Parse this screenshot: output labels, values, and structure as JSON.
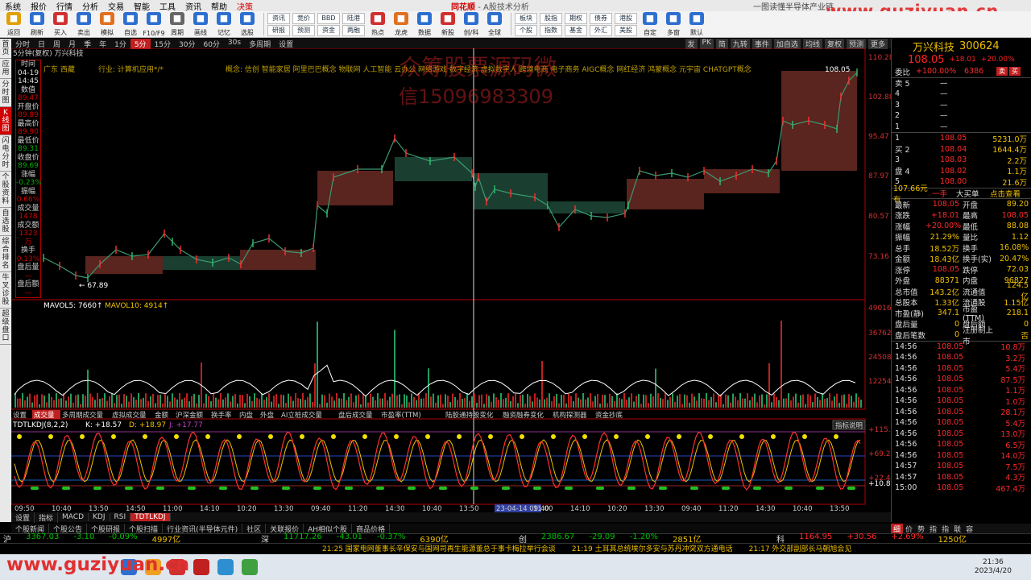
{
  "menu": {
    "items": [
      "系统",
      "报价",
      "行情",
      "分析",
      "交易",
      "智能",
      "工具",
      "资讯",
      "帮助",
      "决策"
    ],
    "app_title_brand": "同花顺",
    "app_title_rest": "- A股技术分析",
    "right_title": "一图读懂半导体产业链"
  },
  "toolbar": {
    "buttons": [
      {
        "label": "返回",
        "icon": "back-icon",
        "color": "#e0a000"
      },
      {
        "label": "刷新",
        "icon": "refresh-icon",
        "color": "#2d6fd0"
      },
      {
        "label": "买入",
        "icon": "buy-icon",
        "color": "#d03030"
      },
      {
        "label": "卖出",
        "icon": "sell-icon",
        "color": "#2d6fd0"
      },
      {
        "label": "模拟",
        "icon": "simulate-icon",
        "color": "#e07020"
      },
      {
        "label": "自选",
        "icon": "watchlist-icon",
        "color": "#2d6fd0"
      },
      {
        "label": "F10/F9",
        "icon": "f10-icon",
        "color": "#2d6fd0"
      },
      {
        "label": "周期",
        "icon": "period-icon",
        "color": "#666"
      },
      {
        "label": "画线",
        "icon": "draw-line-icon",
        "color": "#2d6fd0"
      },
      {
        "label": "记忆",
        "icon": "memory-icon",
        "color": "#2d6fd0"
      },
      {
        "label": "选股",
        "icon": "screener-icon",
        "color": "#2d6fd0"
      }
    ],
    "grid_buttons": [
      [
        "资讯",
        "研报"
      ],
      [
        "竞价",
        "预测"
      ],
      [
        "BBD",
        "资金"
      ],
      [
        "陆港",
        "两融"
      ]
    ],
    "buttons2": [
      {
        "label": "热点",
        "icon": "hot-icon",
        "color": "#d03030"
      },
      {
        "label": "龙虎",
        "icon": "dragon-icon",
        "color": "#e07020"
      },
      {
        "label": "数据",
        "icon": "data-icon",
        "color": "#2d6fd0"
      },
      {
        "label": "新股",
        "icon": "ipo-icon",
        "color": "#d03030"
      },
      {
        "label": "创/科",
        "icon": "star-icon",
        "color": "#2d6fd0"
      },
      {
        "label": "全球",
        "icon": "globe-icon",
        "color": "#2d6fd0"
      }
    ],
    "grid_buttons2": [
      [
        "板块",
        "个股"
      ],
      [
        "股指",
        "指数"
      ],
      [
        "期权",
        "基金"
      ],
      [
        "债券",
        "外汇"
      ],
      [
        "港股",
        "美股"
      ]
    ],
    "buttons3": [
      {
        "label": "自定",
        "icon": "custom-icon",
        "color": "#2d6fd0"
      },
      {
        "label": "多窗",
        "icon": "multiwindow-icon",
        "color": "#2d6fd0"
      },
      {
        "label": "默认",
        "icon": "default-icon",
        "color": "#2d6fd0"
      }
    ]
  },
  "left_tabs": [
    "首页",
    "应用",
    "分时图",
    "K线图",
    "闪电分时",
    "个股资料",
    "自选股",
    "综合排名",
    "牛叉诊股",
    "超级盘口"
  ],
  "period_bar": {
    "items": [
      "分时",
      "日",
      "周",
      "月",
      "季",
      "年",
      "1分",
      "5分",
      "15分",
      "30分",
      "60分",
      "30s",
      "多周期",
      "设置"
    ],
    "active": "5分",
    "right_items": [
      "发",
      "PK",
      "简",
      "九转",
      "事件",
      "加自选",
      "均线",
      "复权",
      "预测",
      "更多"
    ]
  },
  "chart_header": {
    "period": "5分钟(复权)",
    "name": "万兴科技",
    "region": "广东 西藏",
    "industry": "行业: 计算机应用*/*",
    "concept": "概念: 信创 智能家居 阿里巴巴概念 物联网 人工智能 云办公 网络游戏 数字经济 虚拟数字人 跨境电商 电子商务 AIGC概念 网红经济 鸿蒙概念 元宇宙 CHATGPT概念",
    "last_price_label": "108.05",
    "low_label": "67.89"
  },
  "data_window": [
    {
      "label": "时间",
      "value": "04-19\n14:45",
      "cls": "wh"
    },
    {
      "label": "数值",
      "value": "89.47",
      "cls": "val"
    },
    {
      "label": "开盘价",
      "value": "89.89",
      "cls": "val"
    },
    {
      "label": "最高价",
      "value": "89.90",
      "cls": "val"
    },
    {
      "label": "最低价",
      "value": "89.31",
      "cls": "val g"
    },
    {
      "label": "收盘价",
      "value": "89.69",
      "cls": "val g"
    },
    {
      "label": "涨幅",
      "value": "-0.23%",
      "cls": "val g"
    },
    {
      "label": "振幅",
      "value": "0.66%",
      "cls": "val"
    },
    {
      "label": "成交量",
      "value": "1478",
      "cls": "val"
    },
    {
      "label": "成交额",
      "value": "1323万",
      "cls": "val"
    },
    {
      "label": "换手",
      "value": "0.13%",
      "cls": "val"
    },
    {
      "label": "盘后量",
      "value": "—",
      "cls": "val"
    },
    {
      "label": "盘后额",
      "value": "—",
      "cls": "val"
    }
  ],
  "price_axis": [
    "110.28",
    "102.88",
    "95.47",
    "87.97",
    "80.57",
    "73.16"
  ],
  "volume_axis": [
    "49016",
    "36762",
    "24508",
    "12254"
  ],
  "kdj_axis": [
    "115.3",
    "69.26",
    "22.47",
    "10.81"
  ],
  "volume_header": {
    "mavol5": "MAVOL5: 7660↑",
    "mavol10": "MAVOL10: 4914↑"
  },
  "indicator_tabs": [
    "设置",
    "成交量",
    "多周期成交量",
    "虚拟成交量",
    "金额",
    "沪深金额",
    "换手率",
    "内盘",
    "外盘",
    "AI立桩成交量",
    "盘后成交量",
    "市盈率(TTM)",
    "陆股通持股变化",
    "融资融券变化",
    "机构探测器",
    "资金抄底"
  ],
  "indicator_active": "成交量",
  "kdj_header": {
    "title": "TDTLKDJ(8,2,2)",
    "k": "K: +18.57",
    "d": "D: +18.97",
    "j": "J: +17.77",
    "explain": "指标说明"
  },
  "time_axis": [
    "09:50",
    "10:40",
    "13:50",
    "14:50",
    "11:00",
    "14:10",
    "10:20",
    "13:30",
    "09:40",
    "11:20",
    "14:30",
    "10:40",
    "13:50",
    "23-04-14 09:40",
    "11:00",
    "14:10",
    "10:20",
    "13:30",
    "09:40",
    "11:20",
    "14:30",
    "10:40",
    "13:50"
  ],
  "bottom_tabs": [
    "设置",
    "指标",
    "MACD",
    "KDJ",
    "RSI",
    "TDTLKDJ"
  ],
  "sub_tabs": [
    "个股新闻",
    "个股公告",
    "个股研报",
    "个股扫描",
    "行业资讯(半导体元件)",
    "社区",
    "关联报价",
    "AH相似个股",
    "商品价格"
  ],
  "right_panel": {
    "stock_name": "万兴科技",
    "stock_code": "300624",
    "price": "108.05",
    "change": "+18.01",
    "change_pct": "+20.00%",
    "commit_label": "委比",
    "commit_ratio": "+100.00%",
    "commit_diff": "6386",
    "sell_levels": [
      {
        "label": "卖 5",
        "price": "—",
        "vol": ""
      },
      {
        "label": "4",
        "price": "—",
        "vol": ""
      },
      {
        "label": "3",
        "price": "—",
        "vol": ""
      },
      {
        "label": "2",
        "price": "—",
        "vol": ""
      },
      {
        "label": "1",
        "price": "—",
        "vol": ""
      }
    ],
    "buy_levels": [
      {
        "label": "1",
        "price": "108.05",
        "vol": "5231.0万"
      },
      {
        "label": "买 2",
        "price": "108.04",
        "vol": "1644.4万"
      },
      {
        "label": "3",
        "price": "108.03",
        "vol": "2.2万"
      },
      {
        "label": "盘 4",
        "price": "108.02",
        "vol": "1.1万"
      },
      {
        "label": "5",
        "price": "108.00",
        "vol": "21.6万"
      }
    ],
    "bigbuy": {
      "left": "107.66元有",
      "mid": "一手",
      "right": "大买单",
      "link": "点击查看"
    },
    "stats": [
      [
        "最新",
        "108.05",
        "开盘",
        "89.20"
      ],
      [
        "涨跌",
        "+18.01",
        "最高",
        "108.05"
      ],
      [
        "涨幅",
        "+20.00%",
        "最低",
        "88.08"
      ],
      [
        "振幅",
        "21.29%",
        "量比",
        "1.12"
      ],
      [
        "总手",
        "18.52万",
        "换手",
        "16.08%"
      ],
      [
        "金额",
        "18.43亿",
        "换手(实)",
        "20.47%"
      ],
      [
        "涨停",
        "108.05",
        "跌停",
        "72.03"
      ],
      [
        "外盘",
        "88371",
        "内盘",
        "96827"
      ],
      [
        "总市值",
        "143.2亿",
        "流通值",
        "124.5亿"
      ],
      [
        "总股本",
        "1.33亿",
        "流通股",
        "1.15亿"
      ],
      [
        "市盈(静)",
        "347.1",
        "市盈(TTM)",
        "218.1"
      ],
      [
        "盘后量",
        "0",
        "盘后额",
        "0"
      ],
      [
        "盘后笔数",
        "0",
        "注册制上市",
        "否"
      ]
    ],
    "ticks": [
      [
        "14:56",
        "108.05",
        "10.8万"
      ],
      [
        "14:56",
        "108.05",
        "3.2万"
      ],
      [
        "14:56",
        "108.05",
        "5.4万"
      ],
      [
        "14:56",
        "108.05",
        "87.5万"
      ],
      [
        "14:56",
        "108.05",
        "1.1万"
      ],
      [
        "14:56",
        "108.05",
        "1.0万"
      ],
      [
        "14:56",
        "108.05",
        "28.1万"
      ],
      [
        "14:56",
        "108.05",
        "5.4万"
      ],
      [
        "14:56",
        "108.05",
        "13.0万"
      ],
      [
        "14:56",
        "108.05",
        "6.5万"
      ],
      [
        "14:56",
        "108.05",
        "14.0万"
      ],
      [
        "14:57",
        "108.05",
        "7.5万"
      ],
      [
        "14:57",
        "108.05",
        "4.3万"
      ],
      [
        "15:00",
        "108.05",
        "467.4万"
      ]
    ],
    "bottom_tabs": [
      "细",
      "价",
      "势",
      "指",
      "指",
      "联",
      "容"
    ]
  },
  "index_bar": [
    {
      "name": "沪",
      "value": "3367.03",
      "chg": "-3.10",
      "pct": "-0.09%",
      "amt": "4997亿"
    },
    {
      "name": "深",
      "value": "11717.26",
      "chg": "-43.01",
      "pct": "-0.37%",
      "amt": "6390亿"
    },
    {
      "name": "创",
      "value": "2386.67",
      "chg": "-29.09",
      "pct": "-1.20%",
      "amt": "2851亿"
    },
    {
      "name": "科",
      "value": "1164.95",
      "chg": "+30.56",
      "pct": "+2.69%",
      "amt": "1250亿"
    }
  ],
  "news": [
    "21:25 国家电网董事长辛保安与国网司再生能源董总于事卡梅拉举行会谈",
    "21:19 土耳其总统埃尔多安与苏丹冲突双方通电话",
    "21:17 外交部副部长马朝旭会见"
  ],
  "watermark": {
    "url": "www.guziyuan.cn",
    "center1": "众筹股票源码微",
    "center2": "信15096983309"
  },
  "clock": {
    "time": "21:36",
    "date": "2023/4/20"
  },
  "colors": {
    "up": "#ff2a2a",
    "down": "#00c000",
    "bg": "#000000",
    "accent": "#d00000"
  }
}
